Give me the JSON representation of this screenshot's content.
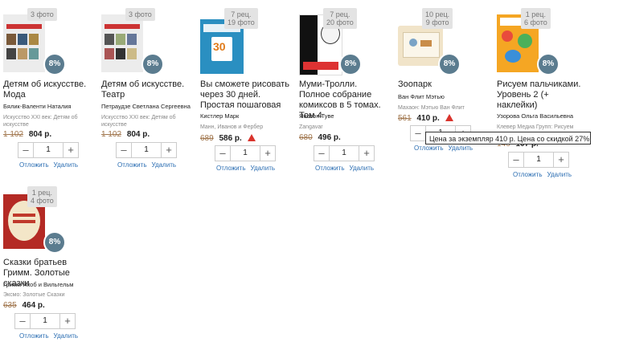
{
  "products": [
    {
      "badge": "3 фото",
      "title": "Детям об искусстве. Мода",
      "author": "Бялик-Валенти Наталия",
      "publisher": "Искусство XXI век: Детям об искусстве",
      "old_price": "1 102",
      "new_price": "804 р.",
      "discount": "8%",
      "qty": "1",
      "cover_color": "#ececec"
    },
    {
      "badge": "3 фото",
      "title": "Детям об искусстве. Театр",
      "author": "Петраудзе Светлана Сергеевна",
      "publisher": "Искусство XXI век: Детям об искусстве",
      "old_price": "1 102",
      "new_price": "804 р.",
      "discount": "8%",
      "qty": "1",
      "cover_color": "#ececec"
    },
    {
      "badge": "7 рец.\n19 фото",
      "title": "Вы сможете рисовать через 30 дней. Простая пошаговая",
      "author": "Кистлер Марк",
      "publisher": "Манн, Иванов и Фербер",
      "old_price": "689",
      "new_price": "586 р.",
      "discount": "",
      "qty": "1",
      "cover_color": "#2a8fc1",
      "warn": true
    },
    {
      "badge": "7 рец.\n20 фото",
      "title": "Муми-Тролли. Полное собрание комиксов в 5 томах. Том 4",
      "author": "Янссон Туве",
      "publisher": "Zangavar",
      "old_price": "680",
      "new_price": "496 р.",
      "discount": "8%",
      "qty": "1",
      "cover_color": "#111111"
    },
    {
      "badge": "10 рец.\n9 фото",
      "title": "Зоопарк",
      "author": "Ван Флит Мэтью",
      "publisher": "Махаон: Мэтью Ван Флит",
      "old_price": "561",
      "new_price": "410 р.",
      "discount": "8%",
      "qty": "1",
      "cover_color": "#f1e4c9",
      "warn": true
    },
    {
      "badge": "1 рец.\n6 фото",
      "title": "Рисуем пальчиками. Уровень 2 (+ наклейки)",
      "author": "Узорова Ольга Васильевна",
      "publisher": "Клевер Медиа Групп: Рисуем",
      "old_price": "146",
      "new_price": "107 р.",
      "discount": "8%",
      "qty": "1",
      "cover_color": "#f5a623"
    },
    {
      "badge": "1 рец.\n4 фото",
      "title": "Сказки братьев Гримм. Золотые сказки",
      "author": "Гримм Якоб и Вильгельм",
      "publisher": "Эксмо: Золотые Сказки",
      "old_price": "635",
      "new_price": "464 р.",
      "discount": "8%",
      "qty": "1",
      "cover_color": "#b42a24"
    }
  ],
  "ui": {
    "minus": "–",
    "plus": "+",
    "postpone": "Отложить",
    "delete": "Удалить",
    "currency": "р."
  },
  "tooltip": "Цена за экземпляр 410 р. Цена со скидкой 27%"
}
